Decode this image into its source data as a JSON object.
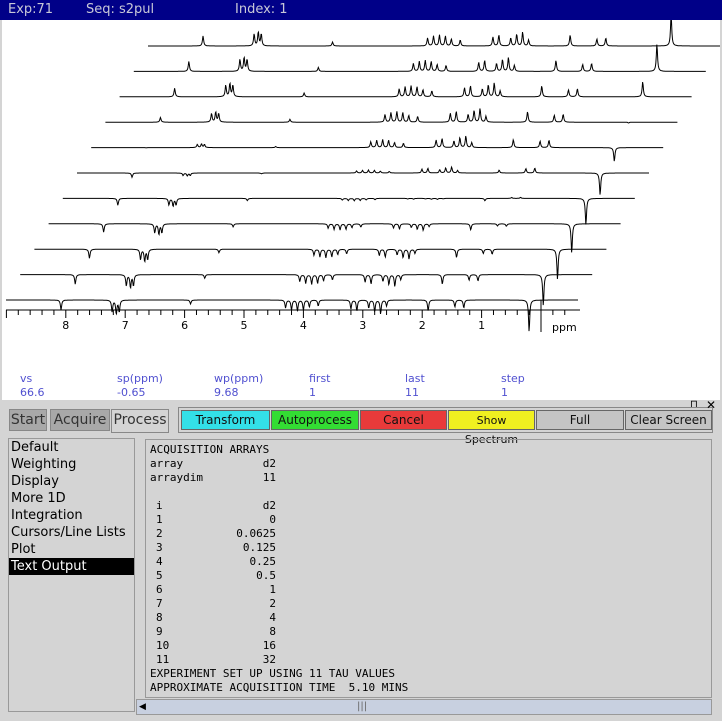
{
  "titlebar": {
    "exp": "Exp:71",
    "seq": "Seq: s2pul",
    "index": "Index: 1"
  },
  "axis": {
    "unit": "ppm",
    "ticks": [
      "8",
      "7",
      "6",
      "5",
      "4",
      "3",
      "2",
      "1"
    ]
  },
  "params": [
    {
      "label": "vs",
      "value": "66.6"
    },
    {
      "label": "sp(ppm)",
      "value": "-0.65"
    },
    {
      "label": "wp(ppm)",
      "value": "9.68"
    },
    {
      "label": "first",
      "value": "1"
    },
    {
      "label": "last",
      "value": "11"
    },
    {
      "label": "step",
      "value": "1"
    }
  ],
  "tabs": [
    {
      "label": "Start"
    },
    {
      "label": "Acquire"
    },
    {
      "label": "Process",
      "active": true
    }
  ],
  "buttons": [
    {
      "label": "Transform",
      "color": "#33e0e8"
    },
    {
      "label": "Autoprocess",
      "color": "#33dd33"
    },
    {
      "label": "Cancel",
      "color": "#e83a3a"
    },
    {
      "label": "Show Spectrum",
      "color": "#f0f020"
    },
    {
      "label": "Full",
      "color": "#c4c4c4"
    },
    {
      "label": "Clear Screen",
      "color": "#c4c4c4"
    }
  ],
  "menu": [
    "Default",
    "Weighting",
    "Display",
    "More 1D",
    "Integration",
    "Cursors/Line Lists",
    "Plot",
    "Text Output"
  ],
  "menu_selected": "Text Output",
  "text_output": {
    "title": "ACQUISITION ARRAYS",
    "array_label": "array",
    "array_value": "d2",
    "arraydim_label": "arraydim",
    "arraydim_value": "11",
    "col_i": "i",
    "col_d2": "d2",
    "rows": [
      [
        "1",
        "0"
      ],
      [
        "2",
        "0.0625"
      ],
      [
        "3",
        "0.125"
      ],
      [
        "4",
        "0.25"
      ],
      [
        "5",
        "0.5"
      ],
      [
        "6",
        "1"
      ],
      [
        "7",
        "2"
      ],
      [
        "8",
        "4"
      ],
      [
        "9",
        "8"
      ],
      [
        "10",
        "16"
      ],
      [
        "11",
        "32"
      ]
    ],
    "footer1": "EXPERIMENT SET UP USING 11 TAU VALUES",
    "footer2": "APPROXIMATE ACQUISITION TIME  5.10 MINS"
  }
}
